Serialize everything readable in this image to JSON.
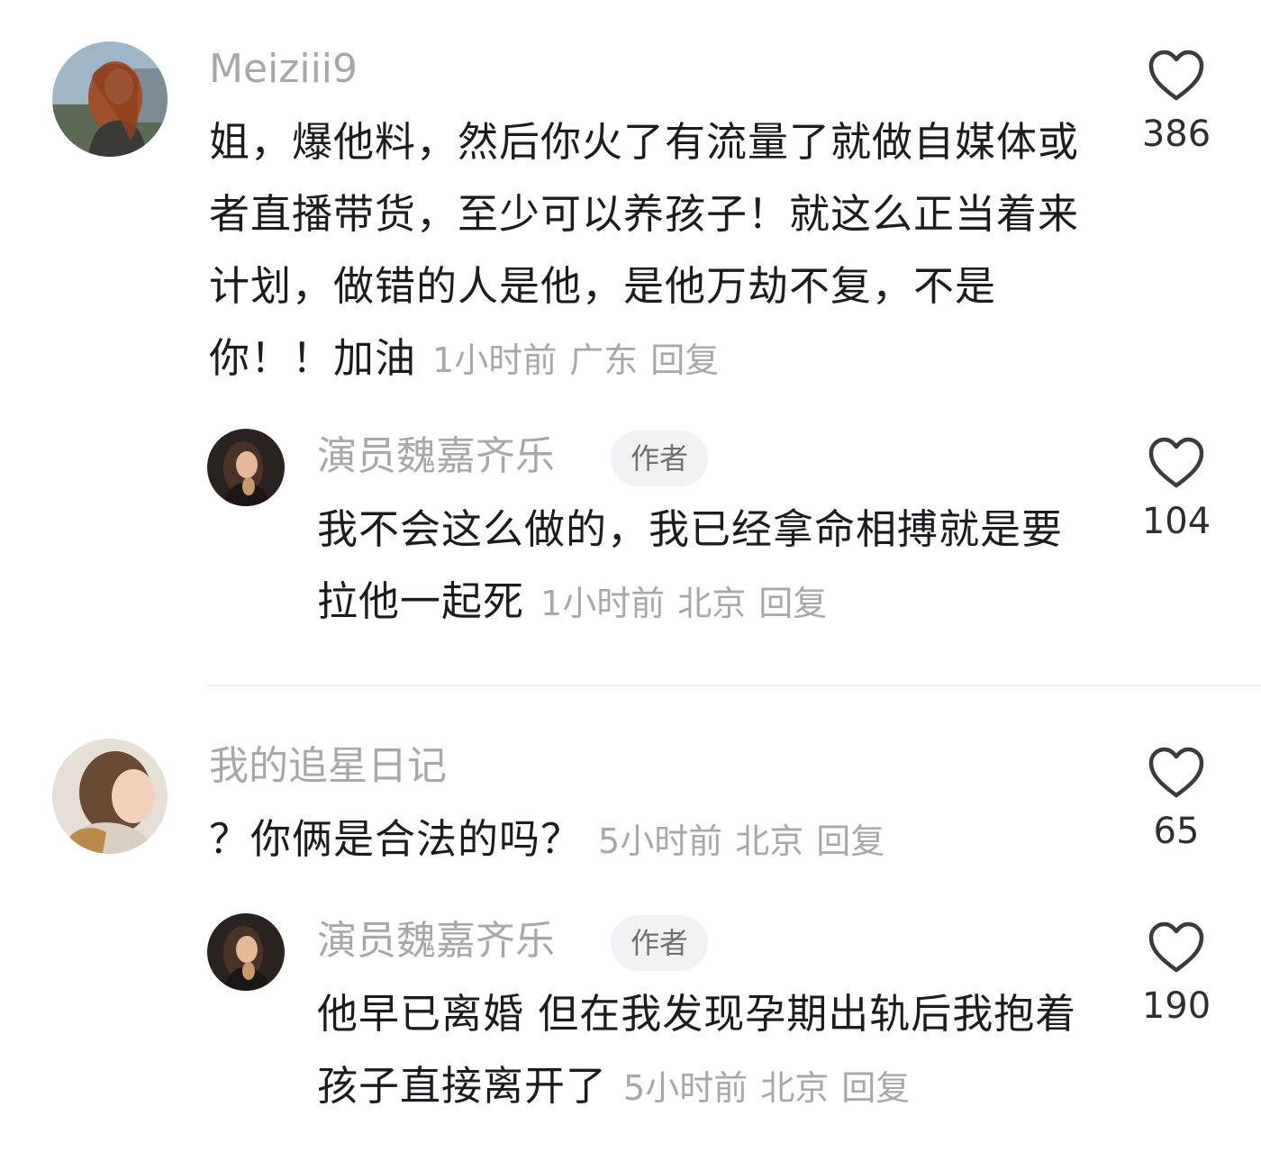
{
  "comments": [
    {
      "username": "Meiziii9",
      "text": "姐，爆他料，然后你火了有流量了就做自媒体或者直播带货，至少可以养孩子！就这么正当着来计划，做错的人是他，是他万劫不复，不是你！！加油",
      "time": "1小时前",
      "location": "广东",
      "reply_label": "回复",
      "likes": "386",
      "reply": {
        "username": "演员魏嘉齐乐",
        "badge": "作者",
        "text": "我不会这么做的，我已经拿命相搏就是要拉他一起死",
        "time": "1小时前",
        "location": "北京",
        "reply_label": "回复",
        "likes": "104"
      }
    },
    {
      "username": "我的追星日记",
      "text": "？你俩是合法的吗？",
      "time": "5小时前",
      "location": "北京",
      "reply_label": "回复",
      "likes": "65",
      "reply": {
        "username": "演员魏嘉齐乐",
        "badge": "作者",
        "text": "他早已离婚  但在我发现孕期出轨后我抱着孩子直接离开了",
        "time": "5小时前",
        "location": "北京",
        "reply_label": "回复",
        "likes": "190"
      }
    }
  ],
  "icons": {
    "like": "heart-outline-icon"
  },
  "colors": {
    "username": "#a8a8ab",
    "text": "#1c1c20",
    "badge_bg": "#f2f2f4",
    "count": "#2e2e33"
  }
}
